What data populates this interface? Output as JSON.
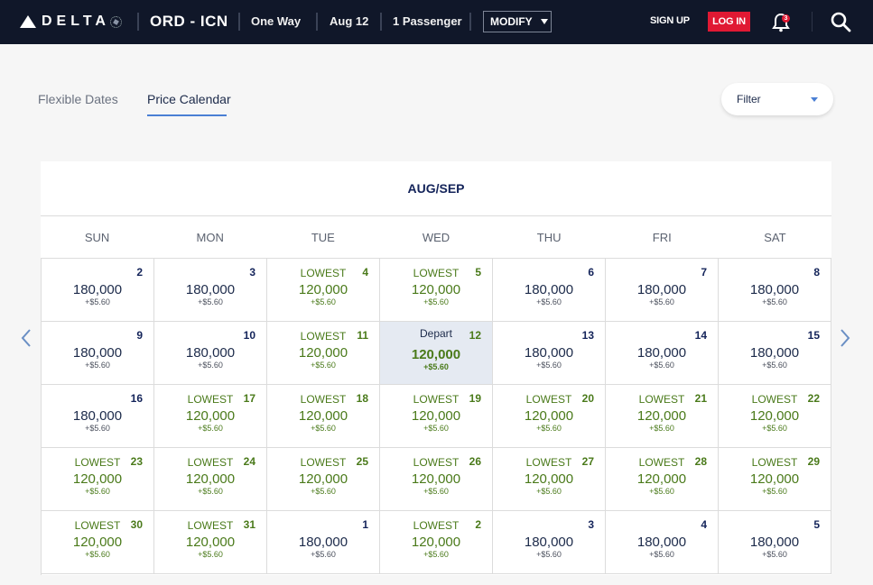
{
  "header": {
    "brand": "DELTA",
    "route": "ORD - ICN",
    "trip_type": "One Way",
    "date": "Aug 12",
    "passengers": "1 Passenger",
    "modify_label": "MODIFY",
    "signup_label": "SIGN UP",
    "login_label": "LOG IN",
    "notification_count": "3"
  },
  "tabs": [
    {
      "label": "Flexible Dates",
      "active": false
    },
    {
      "label": "Price Calendar",
      "active": true
    }
  ],
  "filter": {
    "label": "Filter"
  },
  "calendar": {
    "title": "AUG/SEP",
    "weekdays": [
      "SUN",
      "MON",
      "TUE",
      "WED",
      "THU",
      "FRI",
      "SAT"
    ],
    "lowest_label": "LOWEST",
    "depart_label": "Depart",
    "weeks": [
      [
        {
          "day": "2",
          "price": "180,000",
          "fee": "+$5.60",
          "lowest": false
        },
        {
          "day": "3",
          "price": "180,000",
          "fee": "+$5.60",
          "lowest": false
        },
        {
          "day": "4",
          "price": "120,000",
          "fee": "+$5.60",
          "lowest": true
        },
        {
          "day": "5",
          "price": "120,000",
          "fee": "+$5.60",
          "lowest": true
        },
        {
          "day": "6",
          "price": "180,000",
          "fee": "+$5.60",
          "lowest": false
        },
        {
          "day": "7",
          "price": "180,000",
          "fee": "+$5.60",
          "lowest": false
        },
        {
          "day": "8",
          "price": "180,000",
          "fee": "+$5.60",
          "lowest": false
        }
      ],
      [
        {
          "day": "9",
          "price": "180,000",
          "fee": "+$5.60",
          "lowest": false
        },
        {
          "day": "10",
          "price": "180,000",
          "fee": "+$5.60",
          "lowest": false
        },
        {
          "day": "11",
          "price": "120,000",
          "fee": "+$5.60",
          "lowest": true
        },
        {
          "day": "12",
          "price": "120,000",
          "fee": "+$5.60",
          "lowest": true,
          "selected": true
        },
        {
          "day": "13",
          "price": "180,000",
          "fee": "+$5.60",
          "lowest": false
        },
        {
          "day": "14",
          "price": "180,000",
          "fee": "+$5.60",
          "lowest": false
        },
        {
          "day": "15",
          "price": "180,000",
          "fee": "+$5.60",
          "lowest": false
        }
      ],
      [
        {
          "day": "16",
          "price": "180,000",
          "fee": "+$5.60",
          "lowest": false
        },
        {
          "day": "17",
          "price": "120,000",
          "fee": "+$5.60",
          "lowest": true
        },
        {
          "day": "18",
          "price": "120,000",
          "fee": "+$5.60",
          "lowest": true
        },
        {
          "day": "19",
          "price": "120,000",
          "fee": "+$5.60",
          "lowest": true
        },
        {
          "day": "20",
          "price": "120,000",
          "fee": "+$5.60",
          "lowest": true
        },
        {
          "day": "21",
          "price": "120,000",
          "fee": "+$5.60",
          "lowest": true
        },
        {
          "day": "22",
          "price": "120,000",
          "fee": "+$5.60",
          "lowest": true
        }
      ],
      [
        {
          "day": "23",
          "price": "120,000",
          "fee": "+$5.60",
          "lowest": true
        },
        {
          "day": "24",
          "price": "120,000",
          "fee": "+$5.60",
          "lowest": true
        },
        {
          "day": "25",
          "price": "120,000",
          "fee": "+$5.60",
          "lowest": true
        },
        {
          "day": "26",
          "price": "120,000",
          "fee": "+$5.60",
          "lowest": true
        },
        {
          "day": "27",
          "price": "120,000",
          "fee": "+$5.60",
          "lowest": true
        },
        {
          "day": "28",
          "price": "120,000",
          "fee": "+$5.60",
          "lowest": true
        },
        {
          "day": "29",
          "price": "120,000",
          "fee": "+$5.60",
          "lowest": true
        }
      ],
      [
        {
          "day": "30",
          "price": "120,000",
          "fee": "+$5.60",
          "lowest": true
        },
        {
          "day": "31",
          "price": "120,000",
          "fee": "+$5.60",
          "lowest": true
        },
        {
          "day": "1",
          "price": "180,000",
          "fee": "+$5.60",
          "lowest": false
        },
        {
          "day": "2",
          "price": "120,000",
          "fee": "+$5.60",
          "lowest": true
        },
        {
          "day": "3",
          "price": "180,000",
          "fee": "+$5.60",
          "lowest": false
        },
        {
          "day": "4",
          "price": "180,000",
          "fee": "+$5.60",
          "lowest": false
        },
        {
          "day": "5",
          "price": "180,000",
          "fee": "+$5.60",
          "lowest": false
        }
      ]
    ]
  },
  "colors": {
    "header_bg": "#101729",
    "login_red": "#e01933",
    "lowest_green": "#4a7a1a",
    "navy": "#14245a",
    "accent_blue": "#4a7fd4",
    "selected_bg": "#e5eaf2"
  }
}
